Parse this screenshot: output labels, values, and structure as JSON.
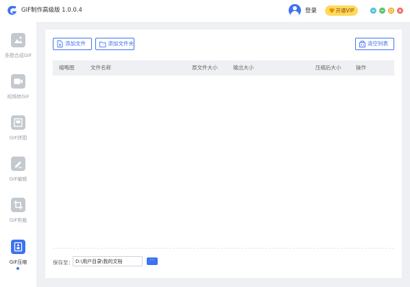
{
  "app": {
    "title": "GIF制作高级版 1.0.0.4"
  },
  "header": {
    "login_label": "登录",
    "vip_label": "开通VIP"
  },
  "colors": {
    "accent": "#3d72f0",
    "vip_bg": "#ffd95a",
    "win_minimize": "#4fc3d9",
    "win_restore": "#5ac46a",
    "win_maximize": "#f5a623",
    "win_close": "#f06a5f"
  },
  "sidebar": {
    "items": [
      {
        "label": "多图合成GIF",
        "icon": "image-merge-icon",
        "active": false
      },
      {
        "label": "视频转GIF",
        "icon": "video-icon",
        "active": false
      },
      {
        "label": "GIF拼图",
        "icon": "collage-icon",
        "active": false
      },
      {
        "label": "GIF编辑",
        "icon": "edit-icon",
        "active": false
      },
      {
        "label": "GIF剪裁",
        "icon": "crop-icon",
        "active": false
      },
      {
        "label": "GIF压缩",
        "icon": "compress-icon",
        "active": true
      }
    ]
  },
  "toolbar": {
    "add_file_label": "添加文件",
    "add_folder_label": "添加文件夹",
    "clear_list_label": "清空列表"
  },
  "table": {
    "columns": [
      "缩略图",
      "文件名称",
      "原文件大小",
      "输出大小",
      "压缩后大小",
      "操作"
    ]
  },
  "footer": {
    "save_label": "保存至：",
    "save_path": "D:\\用户目录\\我的文档",
    "browse_label": "···"
  }
}
